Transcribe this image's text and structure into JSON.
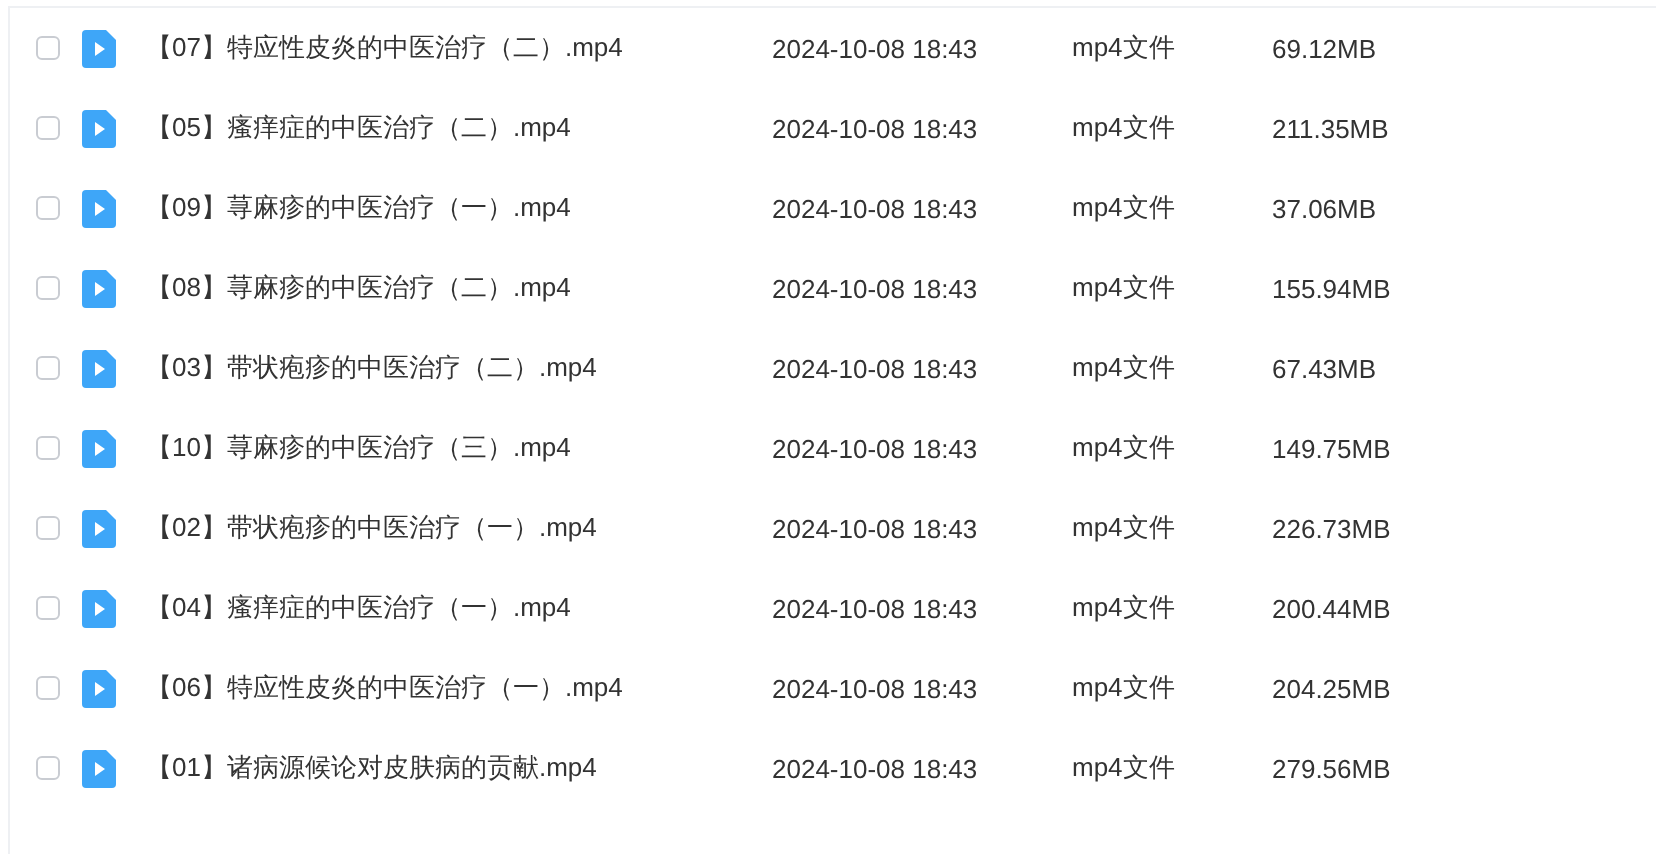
{
  "files": [
    {
      "name": "【07】特应性皮炎的中医治疗（二）.mp4",
      "modified": "2024-10-08 18:43",
      "type": "mp4文件",
      "size": "69.12MB",
      "checked": false
    },
    {
      "name": "【05】瘙痒症的中医治疗（二）.mp4",
      "modified": "2024-10-08 18:43",
      "type": "mp4文件",
      "size": "211.35MB",
      "checked": false
    },
    {
      "name": "【09】荨麻疹的中医治疗（一）.mp4",
      "modified": "2024-10-08 18:43",
      "type": "mp4文件",
      "size": "37.06MB",
      "checked": false
    },
    {
      "name": "【08】荨麻疹的中医治疗（二）.mp4",
      "modified": "2024-10-08 18:43",
      "type": "mp4文件",
      "size": "155.94MB",
      "checked": false
    },
    {
      "name": "【03】带状疱疹的中医治疗（二）.mp4",
      "modified": "2024-10-08 18:43",
      "type": "mp4文件",
      "size": "67.43MB",
      "checked": false
    },
    {
      "name": "【10】荨麻疹的中医治疗（三）.mp4",
      "modified": "2024-10-08 18:43",
      "type": "mp4文件",
      "size": "149.75MB",
      "checked": false
    },
    {
      "name": "【02】带状疱疹的中医治疗（一）.mp4",
      "modified": "2024-10-08 18:43",
      "type": "mp4文件",
      "size": "226.73MB",
      "checked": false
    },
    {
      "name": "【04】瘙痒症的中医治疗（一）.mp4",
      "modified": "2024-10-08 18:43",
      "type": "mp4文件",
      "size": "200.44MB",
      "checked": false
    },
    {
      "name": "【06】特应性皮炎的中医治疗（一）.mp4",
      "modified": "2024-10-08 18:43",
      "type": "mp4文件",
      "size": "204.25MB",
      "checked": false
    },
    {
      "name": "【01】诸病源候论对皮肤病的贡献.mp4",
      "modified": "2024-10-08 18:43",
      "type": "mp4文件",
      "size": "279.56MB",
      "checked": false
    }
  ]
}
